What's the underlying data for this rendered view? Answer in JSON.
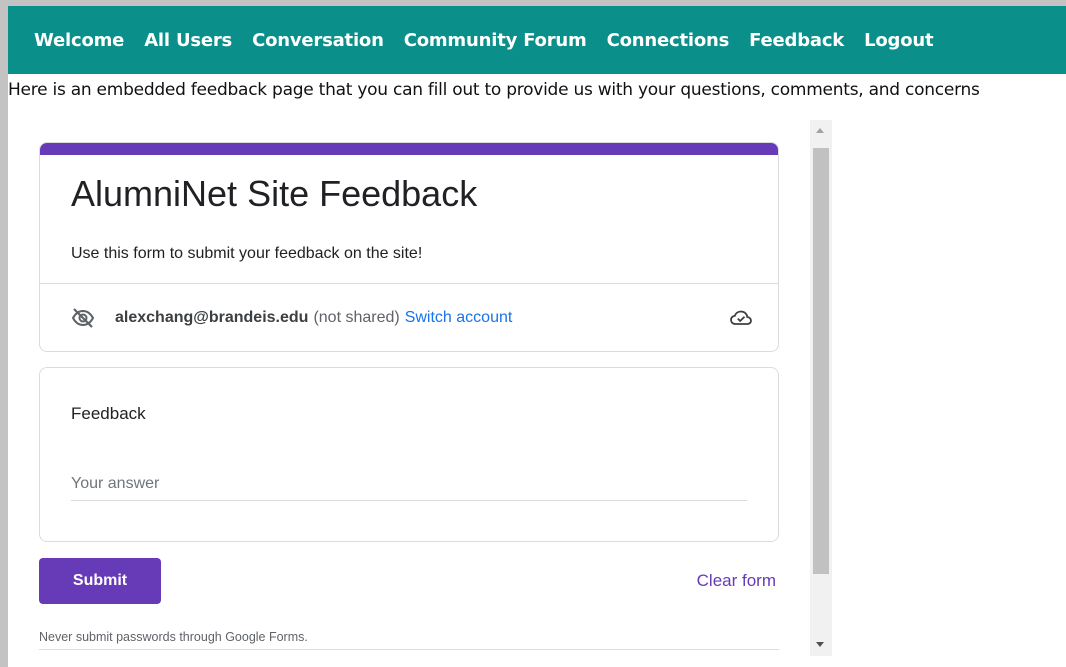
{
  "nav": {
    "items": [
      {
        "label": "Welcome"
      },
      {
        "label": "All Users"
      },
      {
        "label": "Conversation"
      },
      {
        "label": "Community Forum"
      },
      {
        "label": "Connections"
      },
      {
        "label": "Feedback"
      },
      {
        "label": "Logout"
      }
    ],
    "background_color": "#0a8f8a"
  },
  "intro_text": "Here is an embedded feedback page that you can fill out to provide us with your questions, comments, and concerns",
  "form": {
    "title": "AlumniNet Site Feedback",
    "description": "Use this form to submit your feedback on the site!",
    "accent_color": "#673ab7",
    "account": {
      "email": "alexchang@brandeis.edu",
      "note": "(not shared)",
      "switch_label": "Switch account",
      "visibility_icon": "eye-off-icon",
      "cloud_icon": "cloud-check-icon"
    },
    "question": {
      "label": "Feedback",
      "value": "",
      "placeholder": "Your answer"
    },
    "submit_label": "Submit",
    "clear_label": "Clear form",
    "warning": "Never submit passwords through Google Forms."
  }
}
